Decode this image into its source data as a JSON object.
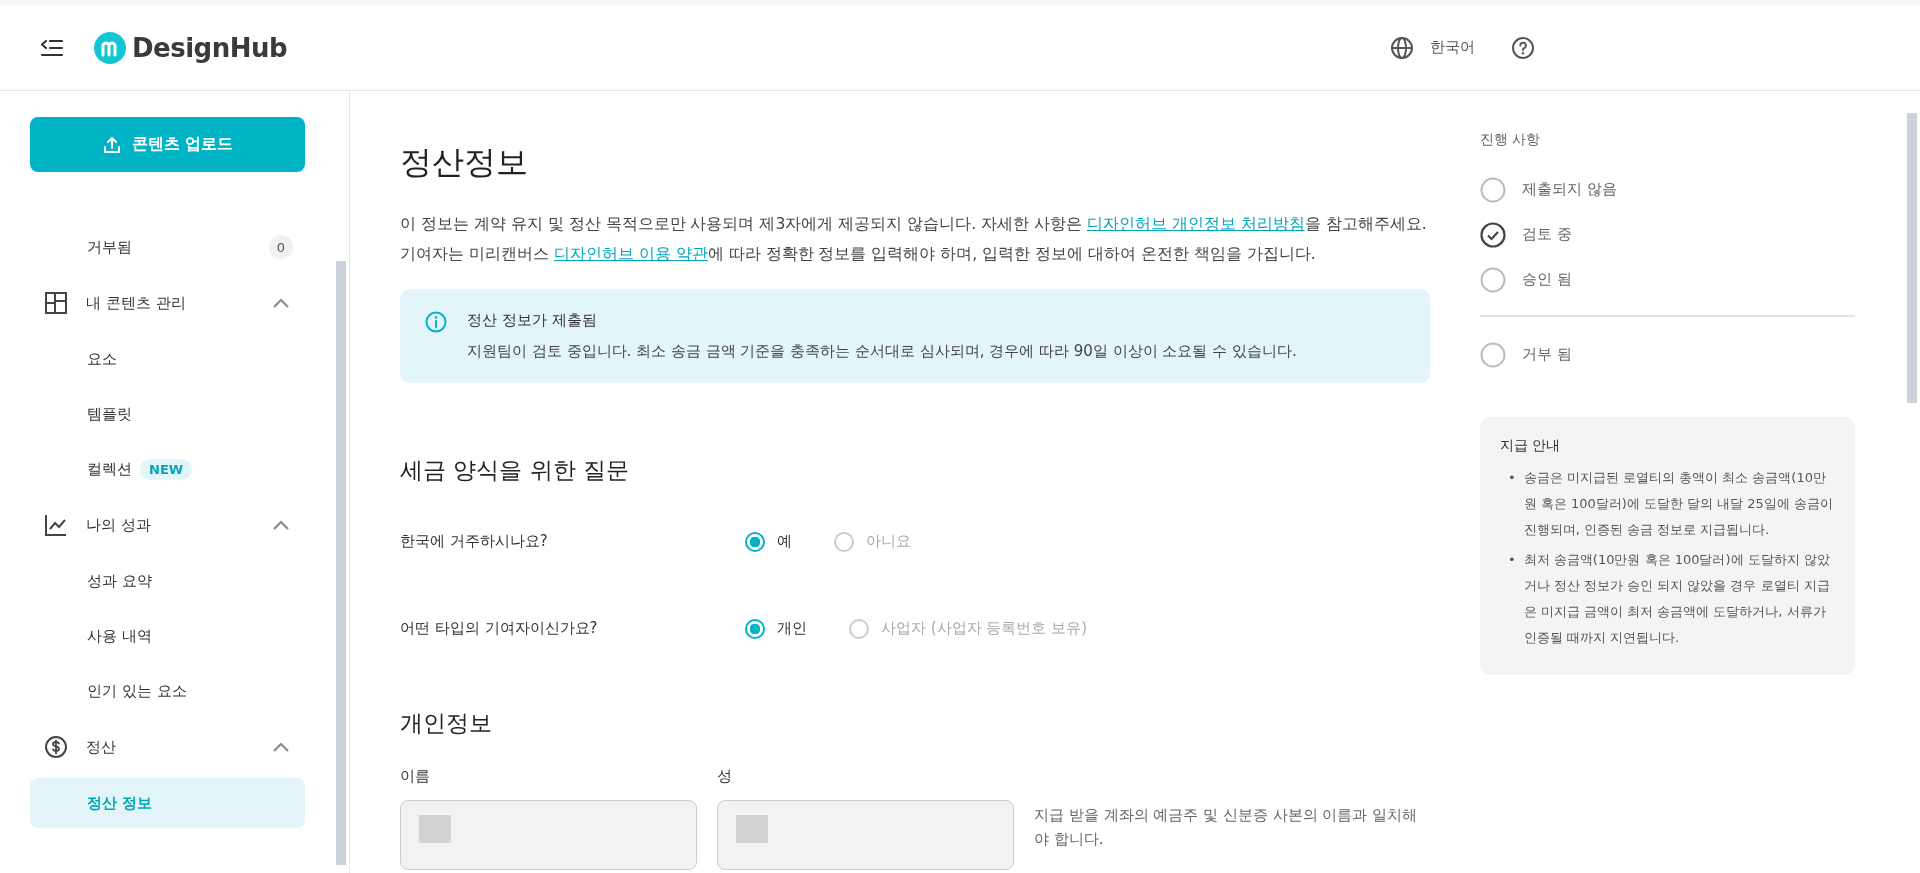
{
  "header": {
    "logo_text": "DesignHub",
    "language": "한국어"
  },
  "sidebar": {
    "upload_button": "콘텐츠 업로드",
    "items": [
      {
        "kind": "item",
        "label": "거부됨",
        "count": "0",
        "selected": false
      },
      {
        "kind": "group",
        "label": "내 콘텐츠 관리",
        "expanded": true,
        "children": [
          {
            "label": "요소",
            "selected": false
          },
          {
            "label": "템플릿",
            "selected": false
          },
          {
            "label": "컬렉션",
            "badge": "NEW",
            "selected": false
          }
        ]
      },
      {
        "kind": "group",
        "label": "나의 성과",
        "expanded": true,
        "children": [
          {
            "label": "성과 요약",
            "selected": false
          },
          {
            "label": "사용 내역",
            "selected": false
          },
          {
            "label": "인기 있는 요소",
            "selected": false
          }
        ]
      },
      {
        "kind": "group",
        "label": "정산",
        "expanded": true,
        "children": [
          {
            "label": "정산 정보",
            "selected": true
          }
        ]
      }
    ]
  },
  "main": {
    "title": "정산정보",
    "intro": [
      {
        "kind": "text",
        "text": "이 정보는 계약 유지 및 정산 목적으로만 사용되며 제3자에게 제공되지 않습니다. 자세한 사항은 "
      },
      {
        "kind": "link",
        "text": "디자인허브 개인정보 처리방침"
      },
      {
        "kind": "text",
        "text": "을 참고해주세요. 기여자는 미리캔버스 "
      },
      {
        "kind": "link",
        "text": "디자인허브 이용 약관"
      },
      {
        "kind": "text",
        "text": "에 따라 정확한 정보를 입력해야 하며, 입력한 정보에 대하여 온전한 책임을 가집니다."
      }
    ],
    "notice": {
      "title": "정산 정보가 제출됨",
      "body": "지원팀이 검토 중입니다. 최소 송금 금액 기준을 충족하는 순서대로 심사되며, 경우에 따라 90일 이상이 소요될 수 있습니다."
    },
    "tax_section": {
      "heading": "세금 양식을 위한 질문",
      "questions": [
        {
          "label": "한국에 거주하시나요?",
          "options": [
            {
              "label": "예",
              "selected": true
            },
            {
              "label": "아니요",
              "selected": false
            }
          ]
        },
        {
          "label": "어떤 타입의 기여자이신가요?",
          "options": [
            {
              "label": "개인",
              "selected": true
            },
            {
              "label": "사업자 (사업자 등록번호 보유)",
              "selected": false
            }
          ]
        }
      ]
    },
    "personal_section": {
      "heading": "개인정보",
      "fields": [
        {
          "label": "이름",
          "masked": true
        },
        {
          "label": "성",
          "masked": true
        }
      ],
      "hint": "지급 받을 계좌의 예금주 및 신분증 사본의 이름과 일치해야 합니다."
    }
  },
  "progress": {
    "heading": "진행 사항",
    "steps": [
      {
        "kind": "step",
        "label": "제출되지 않음",
        "checked": false
      },
      {
        "kind": "step",
        "label": "검토 중",
        "checked": true
      },
      {
        "kind": "step",
        "label": "승인 됨",
        "checked": false
      },
      {
        "kind": "outcome",
        "label": "거부 됨",
        "checked": false
      }
    ]
  },
  "payment_guide": {
    "title": "지급 안내",
    "bullet_marker": "•",
    "bullets": [
      "송금은 미지급된 로열티의 총액이 최소 송금액(10만원 혹은 100달러)에 도달한 달의 내달 25일에 송금이 진행되며, 인증된 송금 정보로 지급됩니다.",
      "최저 송금액(10만원 혹은 100달러)에 도달하지 않았거나 정산 정보가 승인 되지 않았을 경우 로열티 지급은 미지급 금액이 최저 송금액에 도달하거나, 서류가 인증될 때까지 지연됩니다."
    ]
  }
}
